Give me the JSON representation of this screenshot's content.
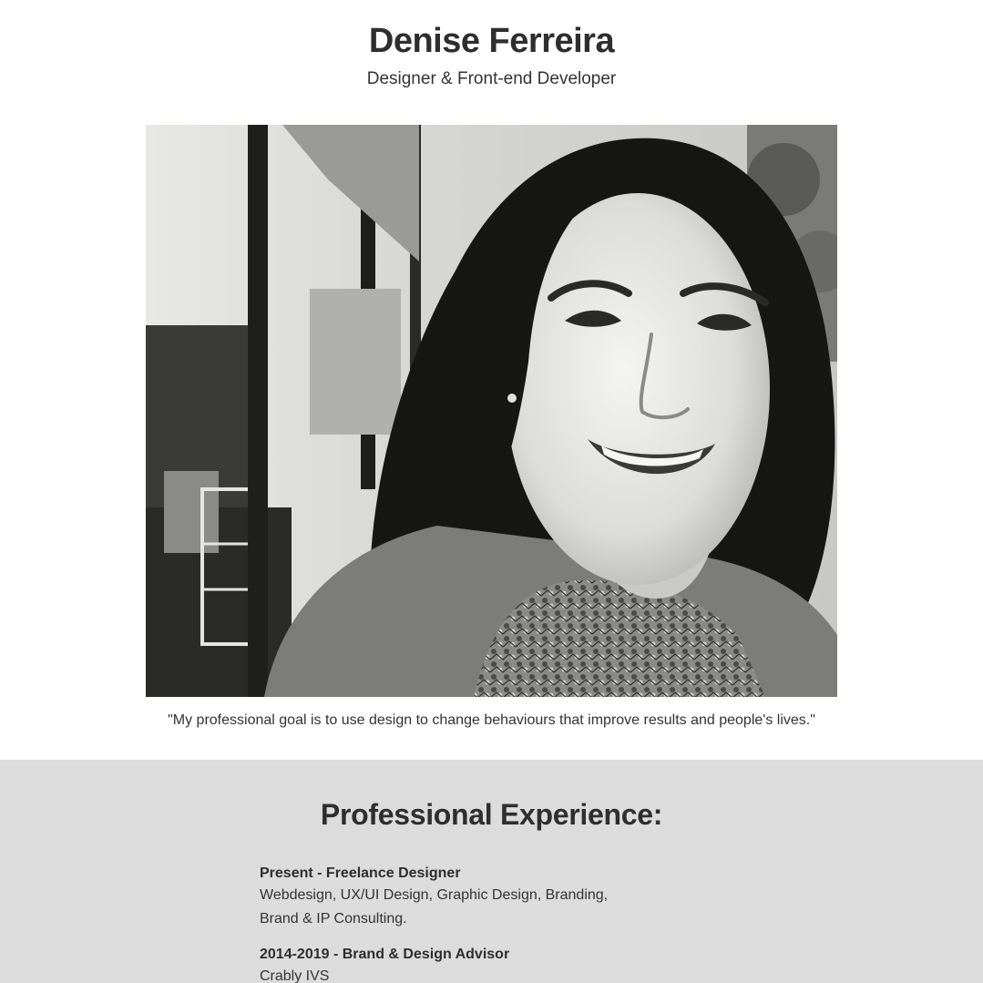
{
  "header": {
    "name": "Denise Ferreira",
    "role": "Designer & Front-end Developer"
  },
  "portrait": {
    "description_icon": "portrait-photo"
  },
  "quote": "\"My professional goal is to use design to change behaviours that improve results and people's lives.\"",
  "experience": {
    "title": "Professional Experience:",
    "jobs": [
      {
        "heading": "Present - Freelance Designer",
        "line1": "Webdesign, UX/UI Design, Graphic Design, Branding,",
        "line2": "Brand & IP Consulting."
      },
      {
        "heading": "2014-2019 - Brand & Design Advisor",
        "line1": "Crably IVS",
        "line2": ""
      }
    ]
  },
  "colors": {
    "text": "#333333",
    "section_bg": "#dcdcdc",
    "page_bg": "#ffffff"
  }
}
